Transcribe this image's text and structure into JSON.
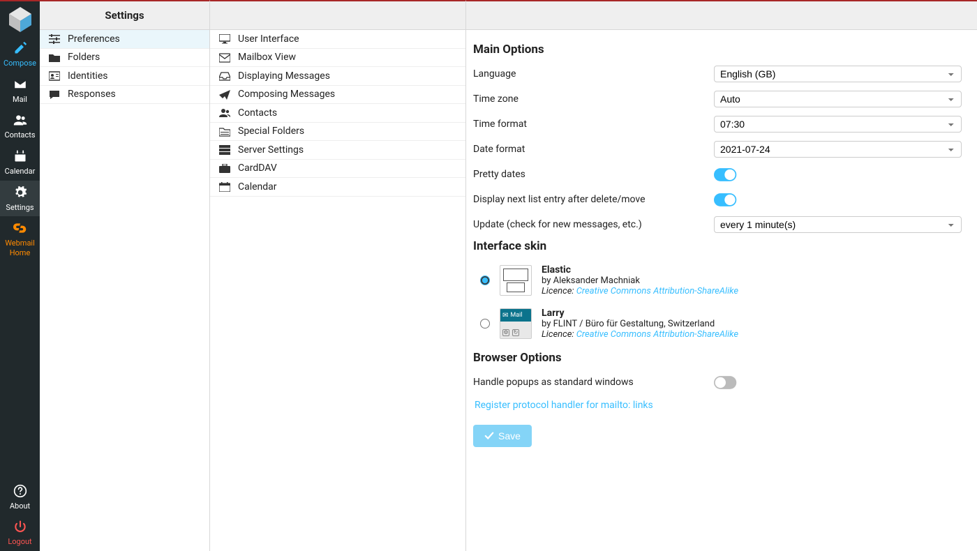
{
  "rail": {
    "compose": "Compose",
    "mail": "Mail",
    "contacts": "Contacts",
    "calendar": "Calendar",
    "settings": "Settings",
    "webmail_home": "Webmail Home",
    "about": "About",
    "logout": "Logout"
  },
  "settings_panel": {
    "header": "Settings",
    "items": [
      {
        "label": "Preferences",
        "icon": "sliders"
      },
      {
        "label": "Folders",
        "icon": "folder"
      },
      {
        "label": "Identities",
        "icon": "id-card"
      },
      {
        "label": "Responses",
        "icon": "comment"
      }
    ]
  },
  "sections_panel": {
    "items": [
      {
        "label": "User Interface",
        "icon": "desktop"
      },
      {
        "label": "Mailbox View",
        "icon": "envelope"
      },
      {
        "label": "Displaying Messages",
        "icon": "inbox"
      },
      {
        "label": "Composing Messages",
        "icon": "paper-plane"
      },
      {
        "label": "Contacts",
        "icon": "users"
      },
      {
        "label": "Special Folders",
        "icon": "folder-special"
      },
      {
        "label": "Server Settings",
        "icon": "server"
      },
      {
        "label": "CardDAV",
        "icon": "briefcase"
      },
      {
        "label": "Calendar",
        "icon": "calendar"
      }
    ]
  },
  "form": {
    "main_options_header": "Main Options",
    "language_label": "Language",
    "language_value": "English (GB)",
    "timezone_label": "Time zone",
    "timezone_value": "Auto",
    "timeformat_label": "Time format",
    "timeformat_value": "07:30",
    "dateformat_label": "Date format",
    "dateformat_value": "2021-07-24",
    "pretty_dates_label": "Pretty dates",
    "pretty_dates_on": true,
    "next_entry_label": "Display next list entry after delete/move",
    "next_entry_on": true,
    "update_label": "Update (check for new messages, etc.)",
    "update_value": "every 1 minute(s)",
    "skin_header": "Interface skin",
    "skins": [
      {
        "name": "Elastic",
        "by": "by Aleksander Machniak",
        "licence_prefix": "Licence: ",
        "licence_link": "Creative Commons Attribution-ShareAlike",
        "selected": true
      },
      {
        "name": "Larry",
        "by": "by FLINT / Büro für Gestaltung, Switzerland",
        "licence_prefix": "Licence: ",
        "licence_link": "Creative Commons Attribution-ShareAlike",
        "selected": false
      }
    ],
    "browser_header": "Browser Options",
    "popups_label": "Handle popups as standard windows",
    "popups_on": false,
    "mailto_link": "Register protocol handler for mailto: links",
    "save_label": "Save",
    "larry_thumb_text": "Mail"
  }
}
